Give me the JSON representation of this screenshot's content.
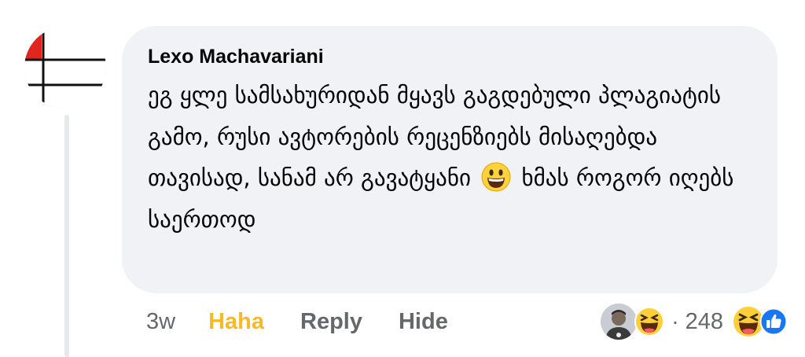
{
  "comment": {
    "author": "Lexo Machavariani",
    "text_before_emoji": "ეგ ყლე სამსახურიდან მყავს გაგდებული პლაგიატის გამო, რუსი ავტორების რეცენზიებს მისაღებდა თავისად, სანამ არ გავატყანი",
    "emoji": "grinning-face",
    "text_after_emoji": "ხმას როგორ იღებს საერთოდ"
  },
  "actions": {
    "time": "3w",
    "haha": "Haha",
    "reply": "Reply",
    "hide": "Hide"
  },
  "reactions": {
    "separator": "·",
    "count": "248",
    "types": [
      "haha",
      "like"
    ]
  },
  "colors": {
    "bubble": "#f0f2f5",
    "text": "#050505",
    "muted": "#65676b",
    "haha": "#f7b928",
    "like": "#1877f2"
  }
}
